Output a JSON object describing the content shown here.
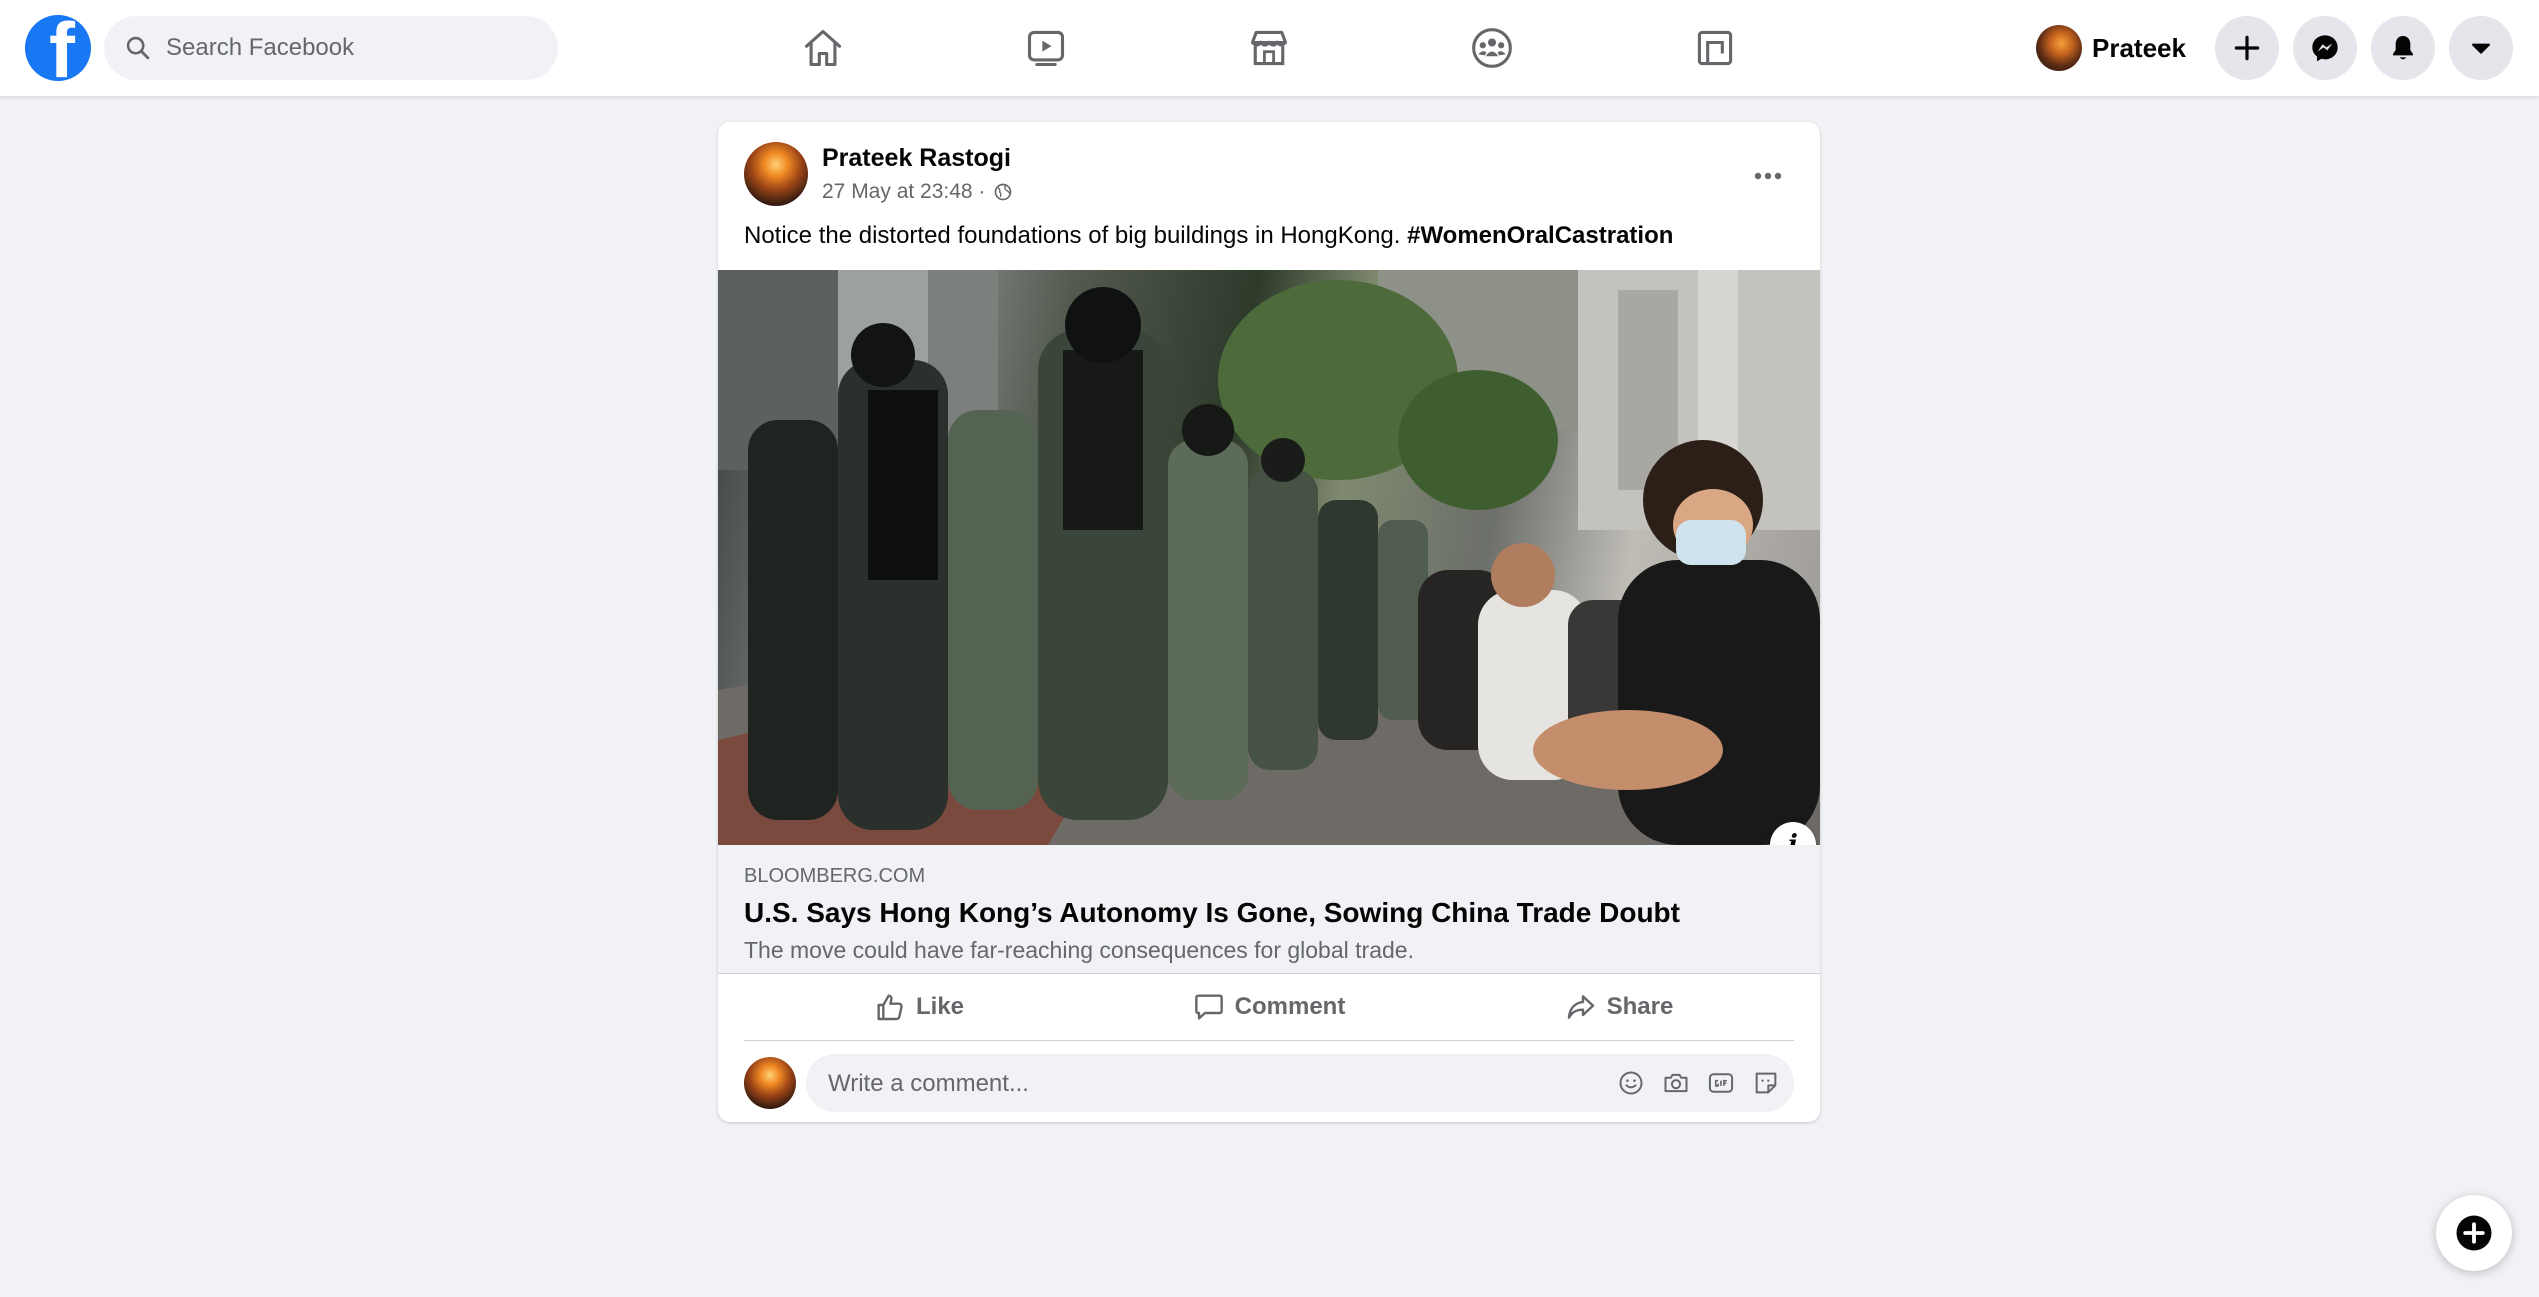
{
  "header": {
    "logo_letter": "f",
    "search": {
      "placeholder": "Search Facebook"
    },
    "nav_tabs": [
      {
        "name": "home-icon"
      },
      {
        "name": "watch-icon"
      },
      {
        "name": "marketplace-icon"
      },
      {
        "name": "groups-icon"
      },
      {
        "name": "gaming-icon"
      }
    ],
    "profile": {
      "name": "Prateek"
    },
    "buttons": [
      "create-icon",
      "messenger-icon",
      "notifications-icon",
      "account-menu-icon"
    ]
  },
  "post": {
    "author": "Prateek Rastogi",
    "timestamp": "27 May at 23:48 ·",
    "privacy_icon": "globe-icon",
    "text": "Notice the distorted foundations of big buildings in HongKong.",
    "hashtag": "#WomenOralCastration",
    "link": {
      "domain": "BLOOMBERG.COM",
      "title": "U.S. Says Hong Kong’s Autonomy Is Gone, Sowing China Trade Doubt",
      "description": "The move could have far-reaching consequences for global trade."
    },
    "info_label": "i",
    "actions": {
      "like": "Like",
      "comment": "Comment",
      "share": "Share"
    },
    "comment_placeholder": "Write a comment...",
    "comment_icons": [
      "emoji-icon",
      "camera-icon",
      "gif-icon",
      "sticker-icon"
    ]
  },
  "colors": {
    "brand": "#1877f2",
    "background": "#f0f2f5",
    "secondary_text": "#65676b",
    "primary_text": "#050505"
  }
}
